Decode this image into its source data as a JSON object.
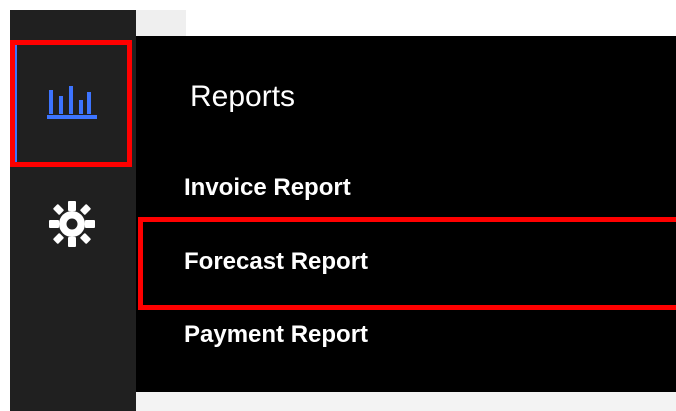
{
  "sidebar": {
    "items": [
      {
        "name": "reports",
        "icon": "bar-chart-icon",
        "active": true
      },
      {
        "name": "settings",
        "icon": "gear-icon",
        "active": false
      }
    ]
  },
  "flyout": {
    "title": "Reports",
    "items": [
      {
        "label": "Invoice Report"
      },
      {
        "label": "Forecast Report"
      },
      {
        "label": "Payment Report"
      }
    ]
  },
  "colors": {
    "rail": "#202020",
    "flyout": "#000000",
    "accent": "#3d74ff",
    "highlight": "#ff0000",
    "text": "#ffffff"
  }
}
